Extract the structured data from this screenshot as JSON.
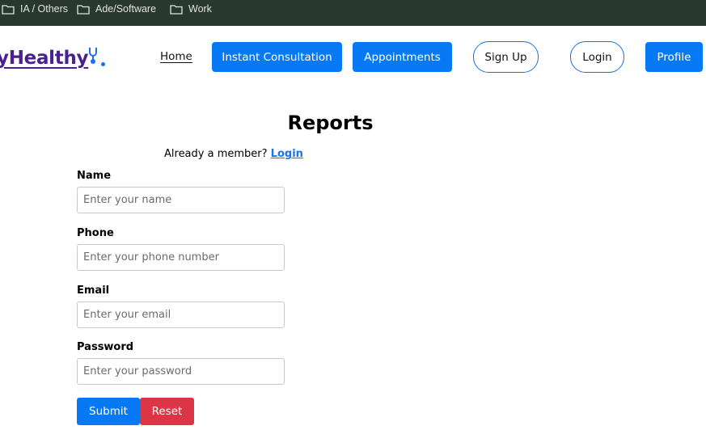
{
  "bookmarks": [
    {
      "label": "IA / Others",
      "icon": "folder-icon"
    },
    {
      "label": "Ade/Software",
      "icon": "folder-icon"
    },
    {
      "label": "Work",
      "icon": "folder-icon"
    }
  ],
  "navbar": {
    "logo_text": "yHealthy",
    "logo_icon": "stethoscope-icon",
    "home_label": "Home",
    "instant_consultation_label": "Instant Consultation",
    "appointments_label": "Appointments",
    "signup_label": "Sign Up",
    "login_label": "Login",
    "profile_label": "Profile"
  },
  "form": {
    "title": "Reports",
    "member_text": "Already a member?",
    "member_link": "Login",
    "fields": {
      "name": {
        "label": "Name",
        "placeholder": "Enter your name",
        "value": ""
      },
      "phone": {
        "label": "Phone",
        "placeholder": "Enter your phone number",
        "value": ""
      },
      "email": {
        "label": "Email",
        "placeholder": "Enter your email",
        "value": ""
      },
      "password": {
        "label": "Password",
        "placeholder": "Enter your password",
        "value": ""
      }
    },
    "submit_label": "Submit",
    "reset_label": "Reset"
  },
  "colors": {
    "bookmarks_bar": "#29382f",
    "primary_blue": "#0879f5",
    "logo_purple": "#4a2290",
    "reset_red": "#dc3545"
  }
}
